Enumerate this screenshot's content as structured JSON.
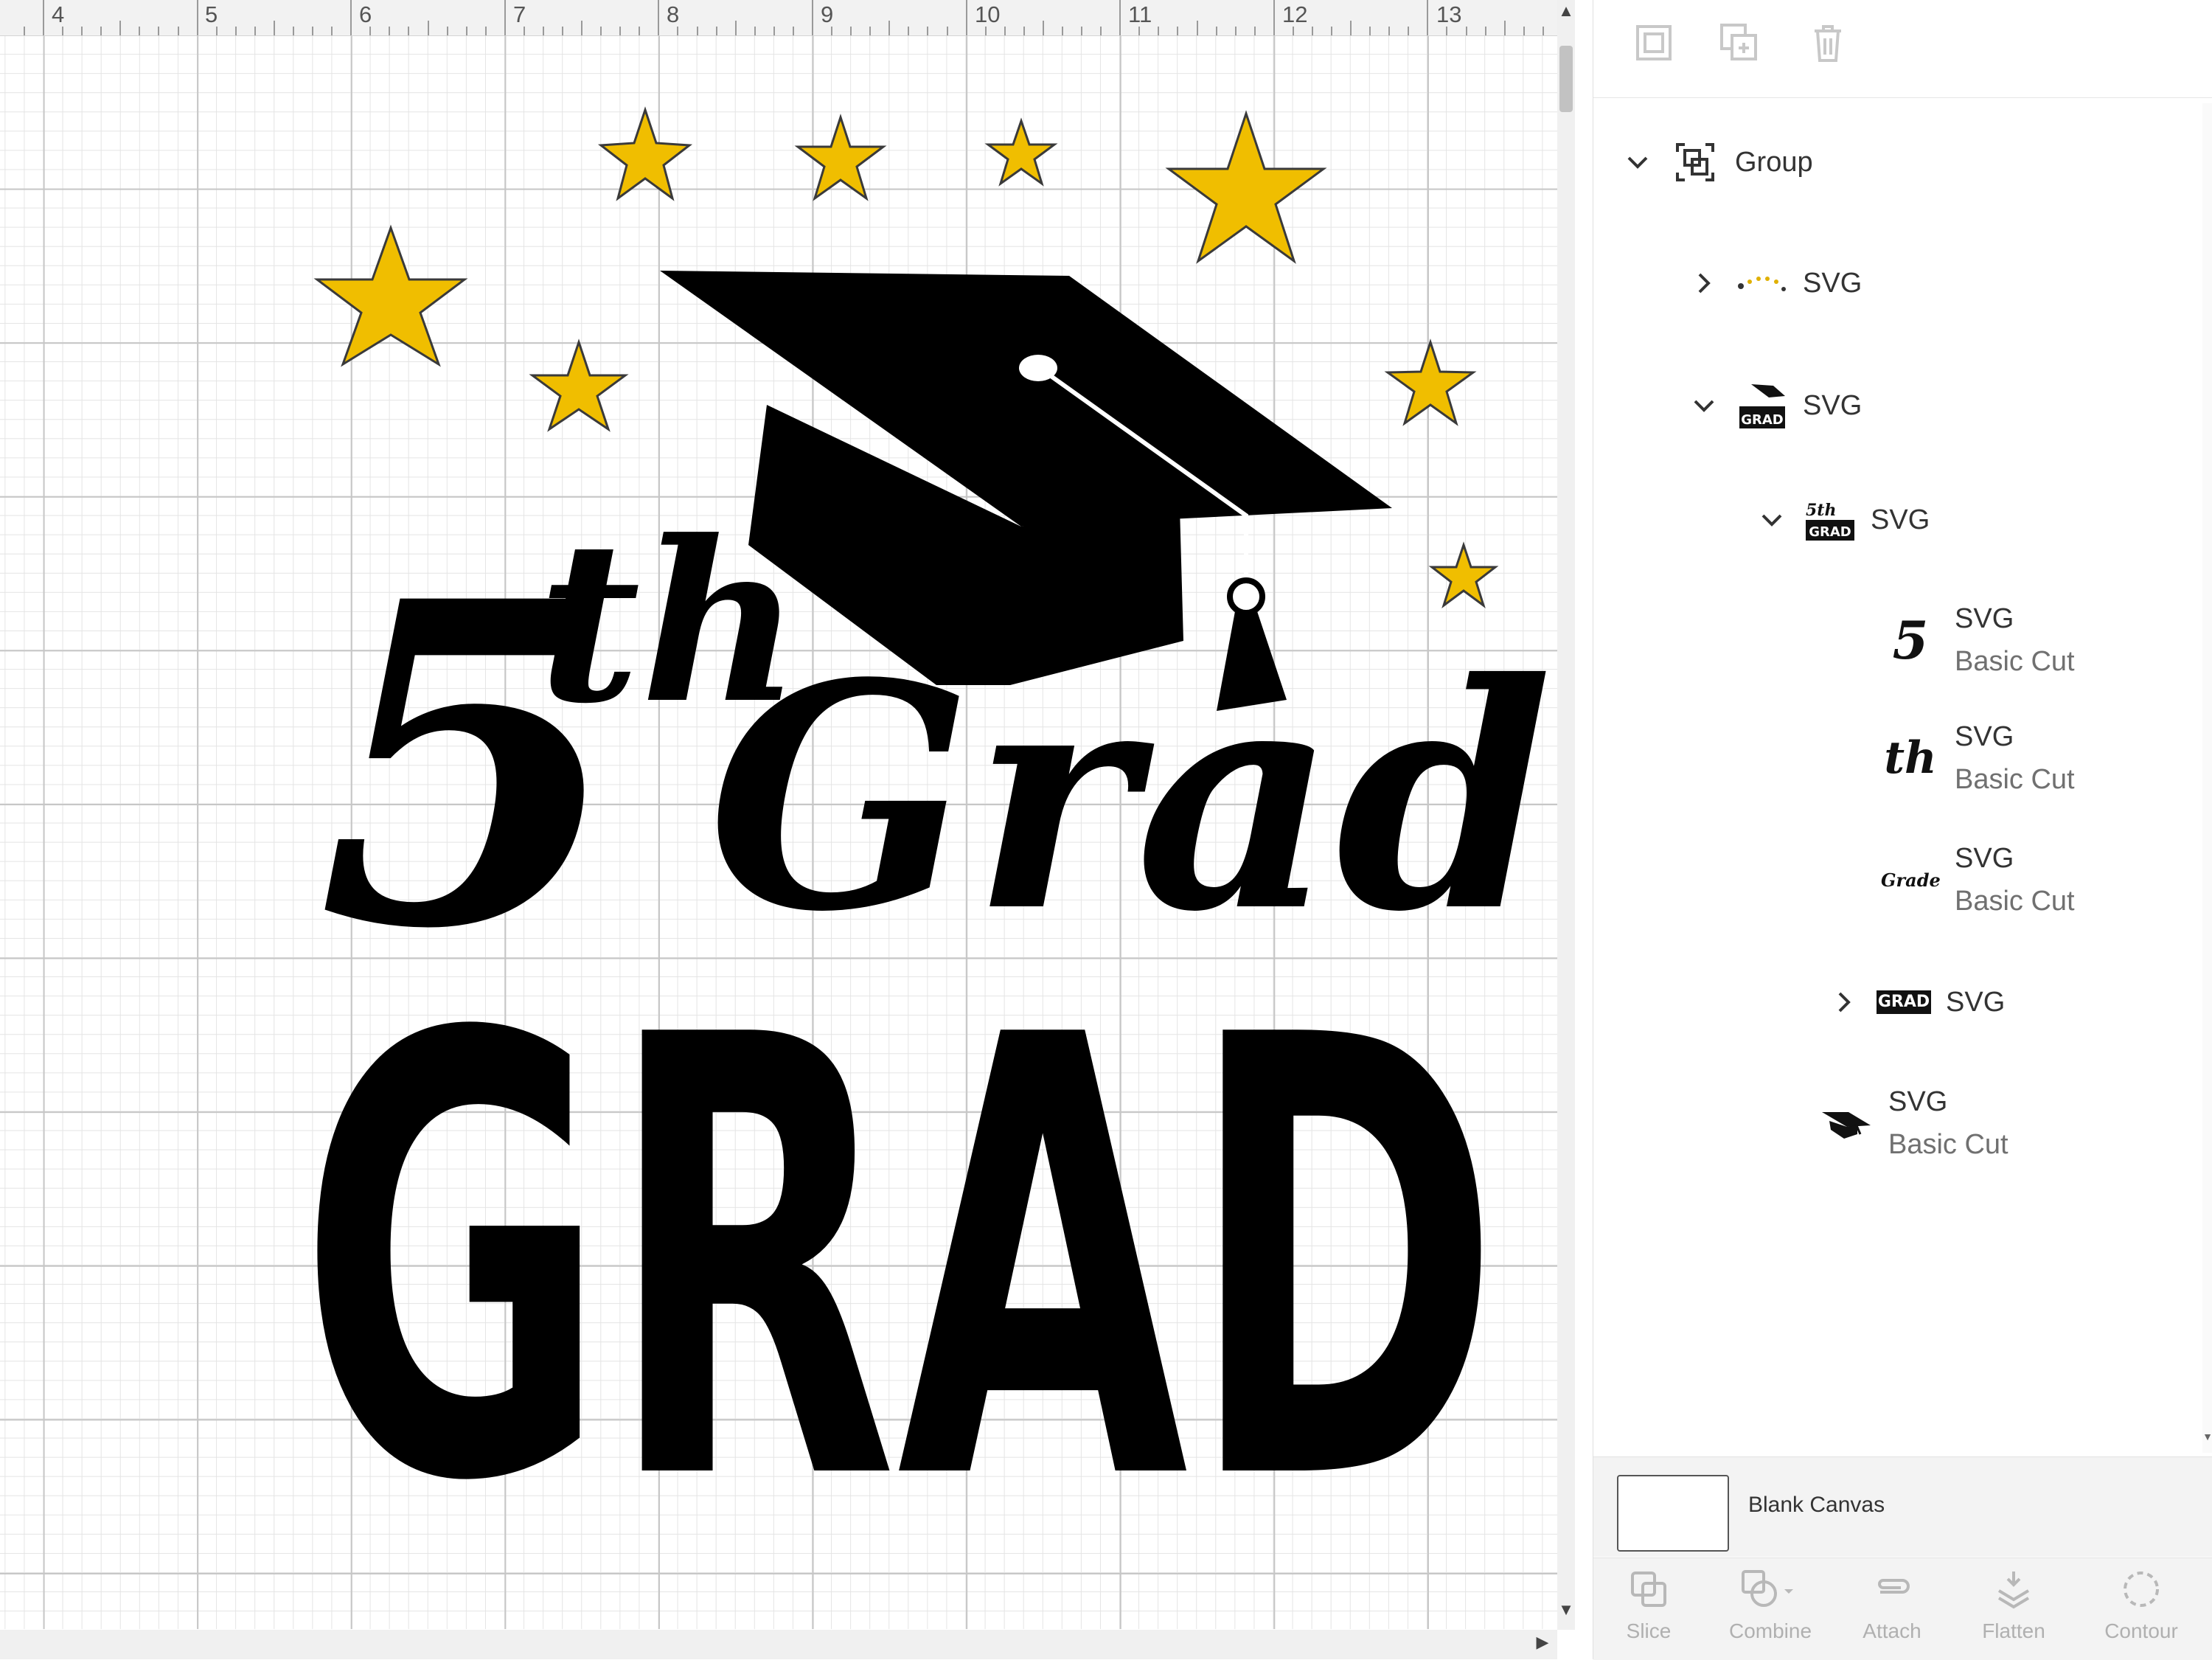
{
  "ruler": {
    "labels": [
      "4",
      "5",
      "6",
      "7",
      "8",
      "9",
      "10",
      "11",
      "12",
      "13"
    ]
  },
  "design": {
    "line1_number": "5",
    "line1_suffix": "th",
    "line2": "Grade",
    "line3": "GRAD",
    "colors": {
      "ink": "#000000",
      "star": "#F0BE00",
      "star_outline": "#3a3a3a"
    }
  },
  "toolbar_top": {
    "icons": [
      "group-icon",
      "duplicate-icon",
      "delete-icon"
    ]
  },
  "layers": {
    "group_label": "Group",
    "items": [
      {
        "label": "SVG",
        "sub": ""
      },
      {
        "label": "SVG",
        "sub": ""
      },
      {
        "label": "SVG",
        "sub": ""
      },
      {
        "label": "SVG",
        "sub": "Basic Cut",
        "thumb_text": "5"
      },
      {
        "label": "SVG",
        "sub": "Basic Cut",
        "thumb_text": "th"
      },
      {
        "label": "SVG",
        "sub": "Basic Cut",
        "thumb_text": "Grade"
      },
      {
        "label": "SVG",
        "sub": "",
        "thumb_text": "GRAD"
      },
      {
        "label": "SVG",
        "sub": "Basic Cut"
      }
    ]
  },
  "blank_canvas": {
    "label": "Blank Canvas"
  },
  "bottom_tools": [
    {
      "label": "Slice",
      "icon": "slice-icon"
    },
    {
      "label": "Combine",
      "icon": "combine-icon"
    },
    {
      "label": "Attach",
      "icon": "attach-icon"
    },
    {
      "label": "Flatten",
      "icon": "flatten-icon"
    },
    {
      "label": "Contour",
      "icon": "contour-icon"
    }
  ]
}
